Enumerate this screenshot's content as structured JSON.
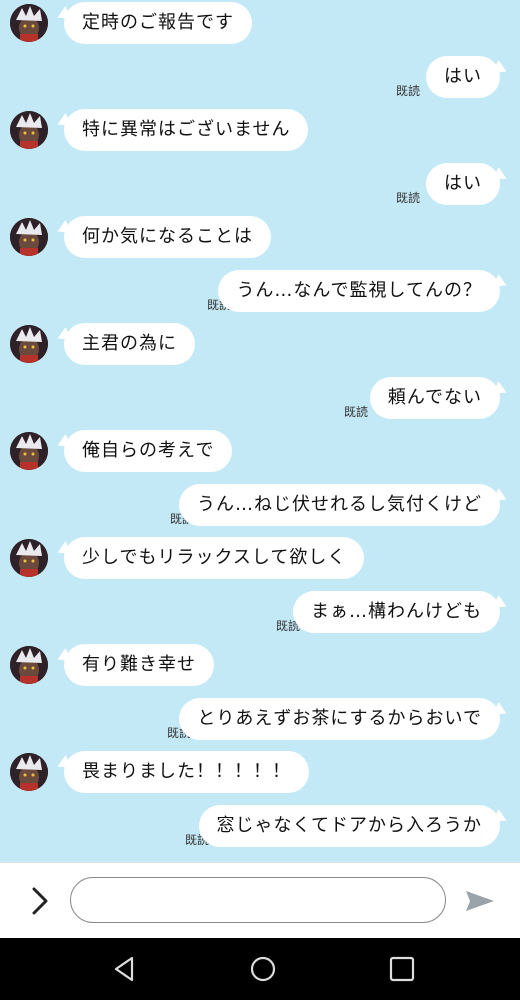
{
  "chat": {
    "read_label": "既読",
    "messages": [
      {
        "side": "in",
        "text": "定時のご報告です"
      },
      {
        "side": "out",
        "text": "はい"
      },
      {
        "side": "in",
        "text": "特に異常はございません"
      },
      {
        "side": "out",
        "text": "はい"
      },
      {
        "side": "in",
        "text": "何か気になることは"
      },
      {
        "side": "out",
        "text": "うん…なんで監視してんの？"
      },
      {
        "side": "in",
        "text": "主君の為に"
      },
      {
        "side": "out",
        "text": "頼んでない"
      },
      {
        "side": "in",
        "text": "俺自らの考えで"
      },
      {
        "side": "out",
        "text": "うん…ねじ伏せれるし気付くけど"
      },
      {
        "side": "in",
        "text": "少しでもリラックスして欲しく"
      },
      {
        "side": "out",
        "text": "まぁ…構わんけども"
      },
      {
        "side": "in",
        "text": "有り難き幸せ"
      },
      {
        "side": "out",
        "text": "とりあえずお茶にするからおいで"
      },
      {
        "side": "in",
        "text": "畏まりました！！！！！"
      },
      {
        "side": "out",
        "text": "窓じゃなくてドアから入ろうか"
      }
    ]
  },
  "input": {
    "placeholder": "",
    "value": ""
  },
  "icons": {
    "expand": "chevron-right-icon",
    "send": "send-icon",
    "back": "nav-back-icon",
    "home": "nav-home-icon",
    "recents": "nav-recents-icon"
  },
  "colors": {
    "chat_background": "#c4e9f6",
    "bubble": "#ffffff",
    "send_icon": "#9aa3aa",
    "nav_bar": "#000000"
  }
}
